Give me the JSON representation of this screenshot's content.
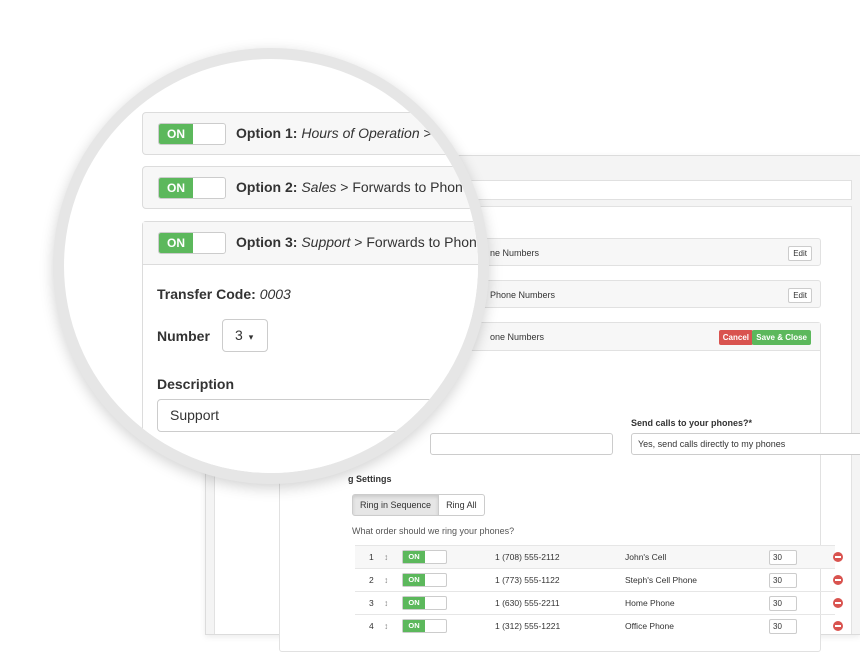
{
  "zoom": {
    "options": [
      {
        "toggle": "ON",
        "prefix": "Option 1:",
        "category": "Hours of Operation",
        "separator": " > ",
        "rest": "…"
      },
      {
        "toggle": "ON",
        "prefix": "Option 2:",
        "category": "Sales",
        "separator": " > ",
        "rest": "Forwards to Phone"
      },
      {
        "toggle": "ON",
        "prefix": "Option 3:",
        "category": "Support",
        "separator": " > ",
        "rest": "Forwards to Phone"
      }
    ],
    "transfer_code_label": "Transfer Code:",
    "transfer_code_value": "0003",
    "number_label": "Number",
    "number_value": "3",
    "number_caret": "▾",
    "description_label": "Description",
    "description_value": "Support"
  },
  "background": {
    "rows": [
      {
        "label": "ne Numbers",
        "edit": "Edit"
      },
      {
        "label": "Phone Numbers",
        "edit": "Edit"
      }
    ],
    "expanded": {
      "label": "one Numbers",
      "cancel": "Cancel",
      "save": "Save & Close",
      "send_label": "Send calls to your phones?*",
      "send_value": "Yes, send calls directly to my phones",
      "send_caret": "⬍",
      "ring_settings_label": "g Settings",
      "ring_modes": [
        "Ring in Sequence",
        "Ring All"
      ],
      "order_question": "What order should we ring your phones?",
      "phones": [
        {
          "index": "1",
          "drag": "↕",
          "toggle": "ON",
          "number": "1 (708) 555-2112",
          "name": "John's Cell",
          "ring": "30"
        },
        {
          "index": "2",
          "drag": "↕",
          "toggle": "ON",
          "number": "1 (773) 555-1122",
          "name": "Steph's Cell Phone",
          "ring": "30"
        },
        {
          "index": "3",
          "drag": "↕",
          "toggle": "ON",
          "number": "1 (630) 555-2211",
          "name": "Home Phone",
          "ring": "30"
        },
        {
          "index": "4",
          "drag": "↕",
          "toggle": "ON",
          "number": "1 (312) 555-1221",
          "name": "Office Phone",
          "ring": "30"
        }
      ]
    }
  },
  "colors": {
    "on_green": "#5cb85c",
    "cancel_red": "#d9534f",
    "lens_ring": "#e6e6e6"
  }
}
